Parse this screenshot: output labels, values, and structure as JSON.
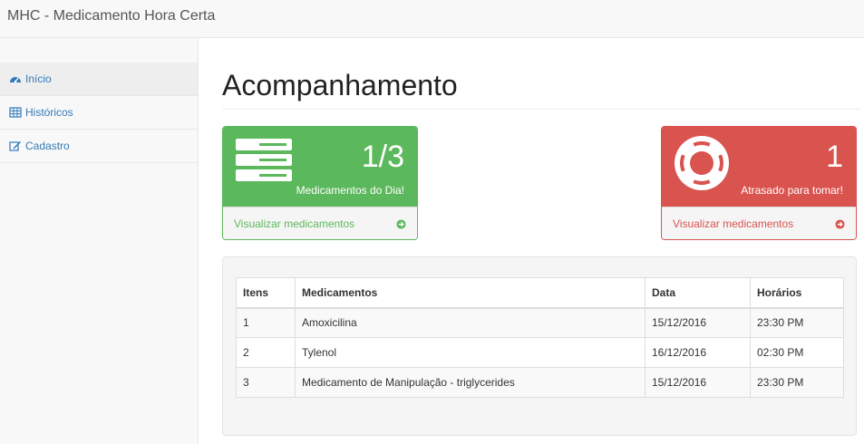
{
  "app": {
    "title": "MHC - Medicamento Hora Certa"
  },
  "sidebar": {
    "items": [
      {
        "label": "Início",
        "icon": "dashboard-icon",
        "active": true
      },
      {
        "label": "Históricos",
        "icon": "table-icon",
        "active": false
      },
      {
        "label": "Cadastro",
        "icon": "edit-icon",
        "active": false
      }
    ]
  },
  "main": {
    "title": "Acompanhamento"
  },
  "panels": {
    "today": {
      "count": "1/3",
      "label": "Medicamentos do Dia!",
      "link": "Visualizar medicamentos",
      "icon": "server-icon",
      "color": "#5cb85c"
    },
    "late": {
      "count": "1",
      "label": "Atrasado para tomar!",
      "link": "Visualizar medicamentos",
      "icon": "life-ring-icon",
      "color": "#d9534f"
    }
  },
  "table": {
    "headers": [
      "Itens",
      "Medicamentos",
      "Data",
      "Horários"
    ],
    "rows": [
      [
        "1",
        "Amoxicilina",
        "15/12/2016",
        "23:30 PM"
      ],
      [
        "2",
        "Tylenol",
        "16/12/2016",
        "02:30 PM"
      ],
      [
        "3",
        "Medicamento de Manipulação - triglycerides",
        "15/12/2016",
        "23:30 PM"
      ]
    ]
  }
}
